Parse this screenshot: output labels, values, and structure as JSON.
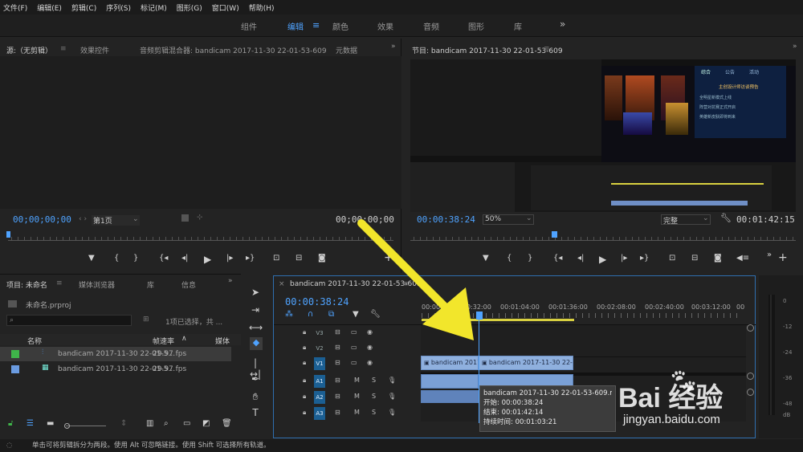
{
  "menu": [
    "文件(F)",
    "编辑(E)",
    "剪辑(C)",
    "序列(S)",
    "标记(M)",
    "图形(G)",
    "窗口(W)",
    "帮助(H)"
  ],
  "workspaces": [
    "组件",
    "编辑",
    "颜色",
    "效果",
    "音频",
    "图形",
    "库"
  ],
  "workspaces_more": "»",
  "source": {
    "tab_source": "源:（无剪辑）",
    "tab_effects": "效果控件",
    "tab_mixer": "音频剪辑混合器: bandicam 2017-11-30 22-01-53-609",
    "tab_meta": "元数据",
    "tc_left": "00;00;00;00",
    "page": "第1页",
    "tc_right": "00;00;00;00"
  },
  "program": {
    "title": "节目: bandicam 2017-11-30 22-01-53-609",
    "tc": "00:00:38:24",
    "zoom": "50%",
    "quality": "完整",
    "duration": "00:01:42:15",
    "preview_nav": [
      "综合",
      "公告",
      "活动"
    ],
    "preview_lines": [
      "主创设计师访谈预告",
      "全明星新模式上线",
      "阵营对抗赛正式开启",
      "英雄新皮肤即将到来"
    ]
  },
  "project": {
    "tab_project": "项目: 未命名",
    "tab_browser": "媒体浏览器",
    "tab_lib": "库",
    "tab_info": "信息",
    "file": "未命名.prproj",
    "search_placeholder": "",
    "selection": "1项已选择，共 ...",
    "col_name": "名称",
    "col_fps": "帧速率",
    "col_media": "媒体",
    "items": [
      {
        "name": "bandicam 2017-11-30 22-01-5...",
        "fps": "29.97 fps",
        "color": "#3fb54a"
      },
      {
        "name": "bandicam 2017-11-30 22-01-5...",
        "fps": "29.97 fps",
        "color": "#6b9be0"
      }
    ]
  },
  "timeline": {
    "tab": "bandicam 2017-11-30 22-01-53-609",
    "tc": "00:00:38:24",
    "ruler": [
      "00:00",
      "00:00:32:00",
      "00:01:04:00",
      "00:01:36:00",
      "00:02:08:00",
      "00:02:40:00",
      "00:03:12:00",
      "00"
    ],
    "tracks_v": [
      "V3",
      "V2",
      "V1"
    ],
    "tracks_a": [
      "A1",
      "A2",
      "A3"
    ],
    "clip_name_1": "bandicam 2017",
    "clip_name_2": "bandicam 2017-11-30 22-01-53",
    "tooltip": {
      "name": "bandicam 2017-11-30 22-01-53-609.m",
      "start": "开始: 00:00:38:24",
      "end": "结束: 00:01:42:14",
      "dur": "持续时间: 00:01:03:21"
    }
  },
  "meter_labels": [
    "0",
    "-12",
    "-24",
    "-36",
    "-48",
    "dB"
  ],
  "status": "单击可将剪辑拆分为两段。使用 Alt 可忽略链接。使用 Shift 可选择所有轨道。",
  "watermark": {
    "brand": "Bai 经验",
    "url": "jingyan.baidu.com"
  },
  "colors": {
    "accent": "#4fa3ff",
    "arrow": "#f2e62b",
    "clip": "#8fb0de"
  }
}
